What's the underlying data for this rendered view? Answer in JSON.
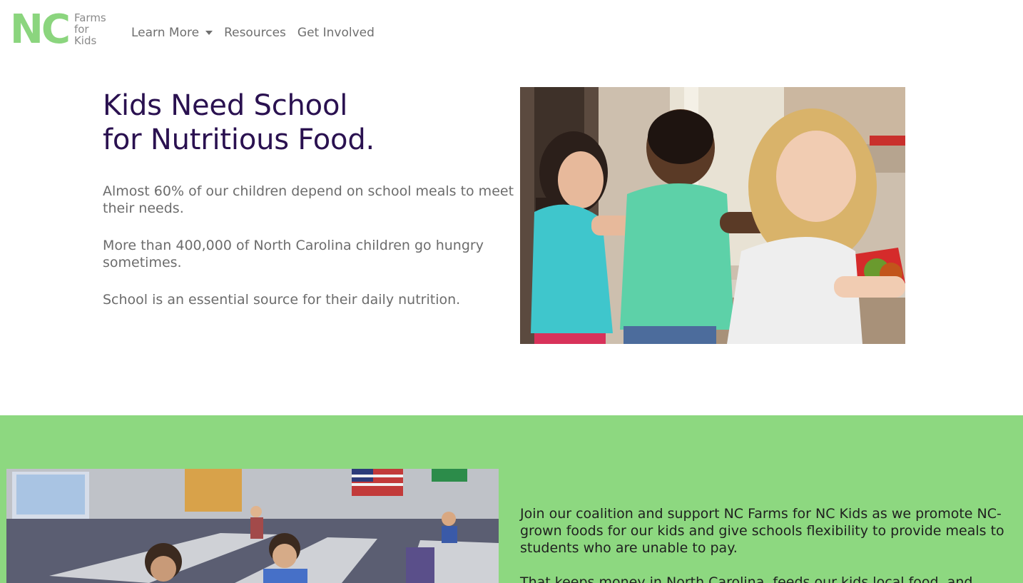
{
  "brand": {
    "logo_mark": "NC",
    "logo_lines": [
      "Farms",
      "for",
      "Kids"
    ],
    "accent_color": "#8dd880"
  },
  "nav": {
    "items": [
      {
        "label": "Learn More",
        "has_dropdown": true
      },
      {
        "label": "Resources"
      },
      {
        "label": "Get Involved"
      }
    ]
  },
  "hero": {
    "title_line1": "Kids Need School",
    "title_line2": "for Nutritious Food.",
    "paragraphs": [
      "Almost 60% of our children depend on school meals to meet their needs.",
      "More than 400,000 of North Carolina children go hungry sometimes.",
      "School is an essential source for their daily nutrition."
    ],
    "title_color": "#2a1150"
  },
  "coalition": {
    "paragraphs": [
      "Join our coalition and support NC Farms for NC Kids as we promote NC-grown foods for our kids and give schools flexibility to provide meals to students who are unable to pay.",
      "That keeps money in North Carolina, feeds our kids local food, and"
    ]
  }
}
